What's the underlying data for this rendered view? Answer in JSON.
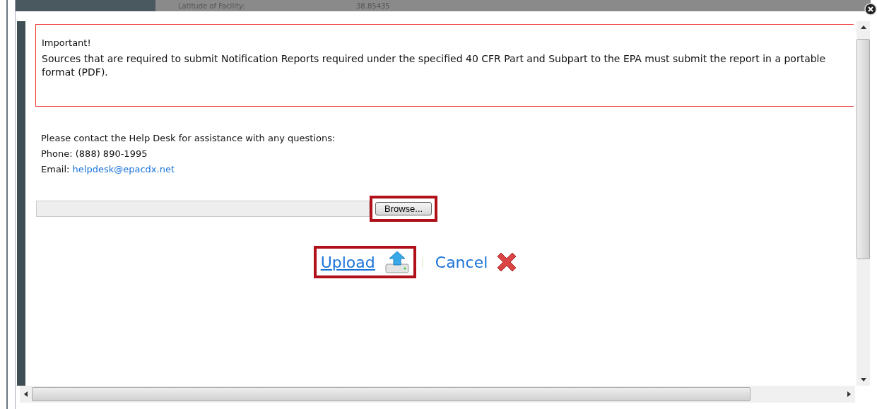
{
  "background_row": {
    "label": "Latitude of Facility:",
    "value": "38.85435"
  },
  "notice": {
    "title": "Important!",
    "text": "Sources that are required to submit Notification Reports required under the specified 40 CFR Part and Subpart to the EPA must submit the report in a portable format (PDF)."
  },
  "help": {
    "intro": "Please contact the Help Desk for assistance with any questions:",
    "phone": "Phone: (888) 890-1995",
    "email_label": "Email:",
    "email": "helpdesk@epacdx.net"
  },
  "file_field": {
    "button": "Browse..."
  },
  "actions": [
    {
      "kind": "upload",
      "label": "Upload"
    },
    {
      "kind": "cancel",
      "label": "Cancel"
    }
  ]
}
